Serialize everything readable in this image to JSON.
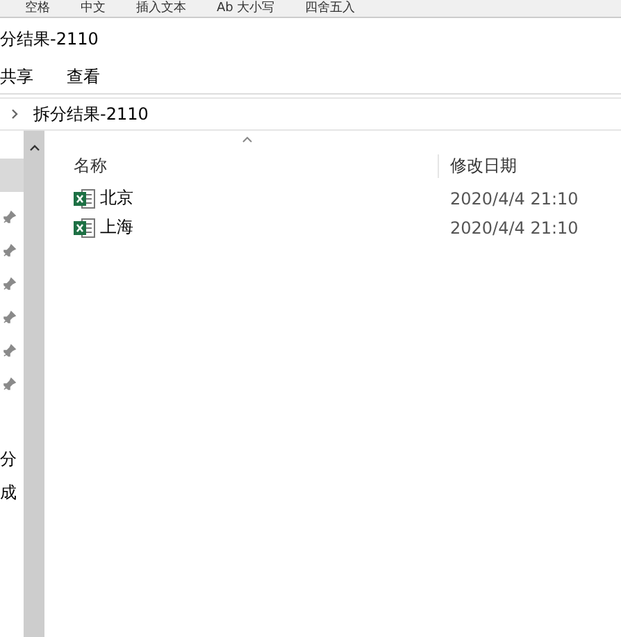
{
  "background_toolbar": {
    "items": [
      "空格",
      "中文",
      "插入文本",
      "Ab 大小写",
      "四舍五入"
    ]
  },
  "window": {
    "title": "分结果-2110"
  },
  "menu": [
    "共享",
    "查看"
  ],
  "address_bar": {
    "path": "拆分结果-2110"
  },
  "nav_pane": {
    "items": [
      {
        "kind": "selected"
      },
      {
        "kind": "pinned"
      },
      {
        "kind": "pinned"
      },
      {
        "kind": "pinned"
      },
      {
        "kind": "pinned"
      },
      {
        "kind": "pinned"
      },
      {
        "kind": "pinned"
      },
      {
        "kind": "text",
        "label": "分"
      },
      {
        "kind": "text",
        "label": "成"
      }
    ]
  },
  "table": {
    "columns": [
      "名称",
      "修改日期"
    ],
    "rows": [
      {
        "name": "北京",
        "date": "2020/4/4 21:10"
      },
      {
        "name": "上海",
        "date": "2020/4/4 21:10"
      }
    ]
  }
}
